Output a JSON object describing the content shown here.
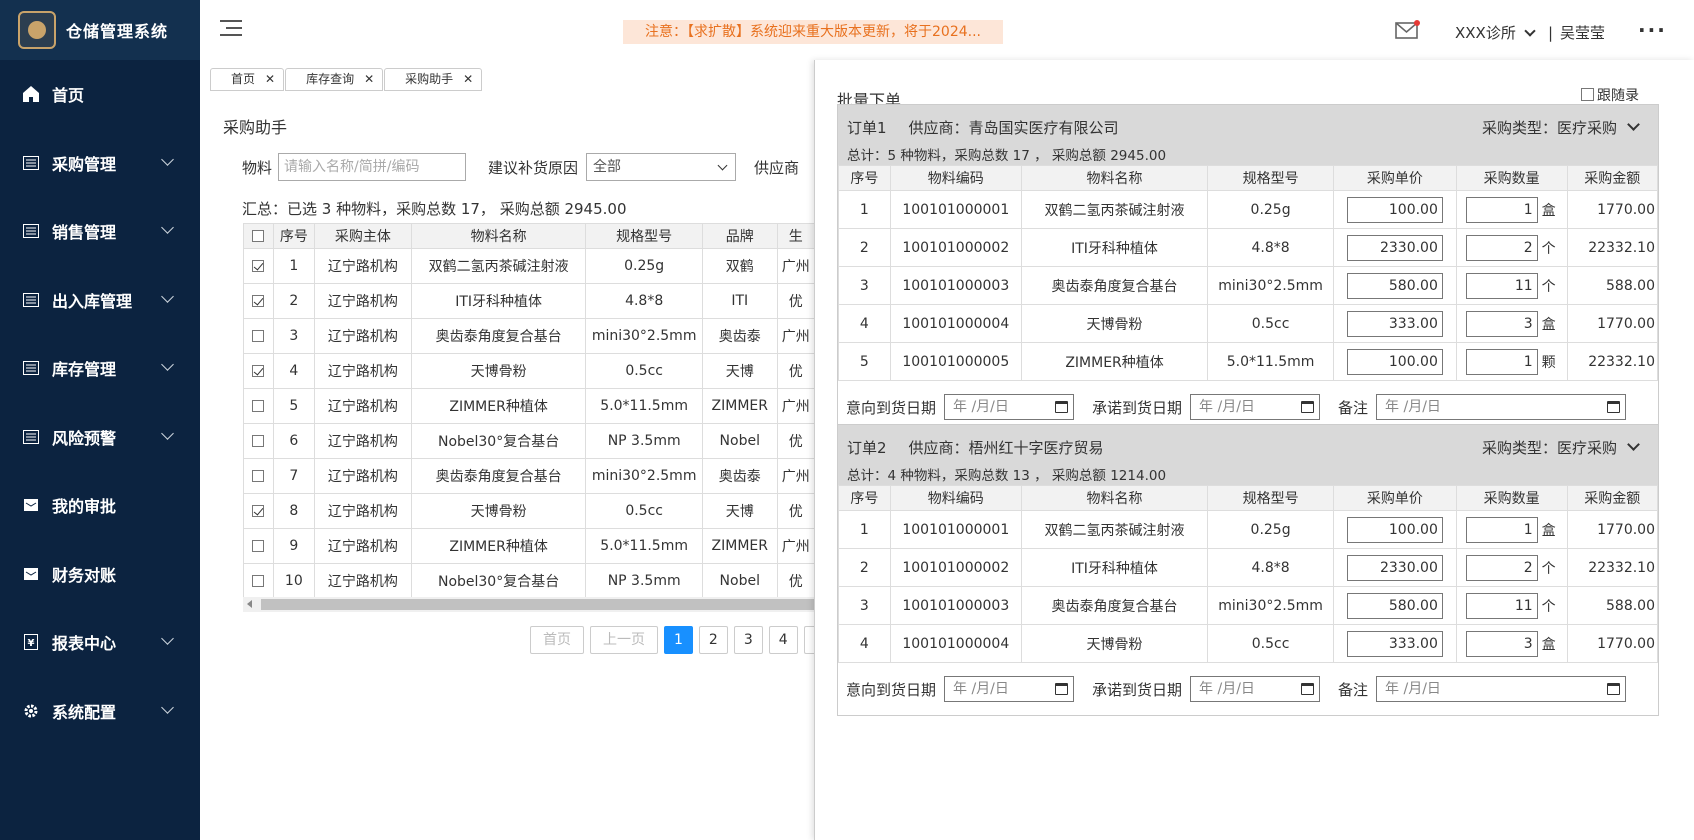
{
  "app": {
    "name": "仓储管理系统"
  },
  "sidebar": {
    "items": [
      {
        "label": "首页",
        "icon": "home-icon",
        "expandable": false
      },
      {
        "label": "采购管理",
        "icon": "list-icon",
        "expandable": true
      },
      {
        "label": "销售管理",
        "icon": "list-icon",
        "expandable": true
      },
      {
        "label": "出入库管理",
        "icon": "list-icon",
        "expandable": true
      },
      {
        "label": "库存管理",
        "icon": "list-icon",
        "expandable": true
      },
      {
        "label": "风险预警",
        "icon": "list-icon",
        "expandable": true
      },
      {
        "label": "我的审批",
        "icon": "inbox-icon",
        "expandable": false
      },
      {
        "label": "财务对账",
        "icon": "inbox-icon",
        "expandable": false
      },
      {
        "label": "报表中心",
        "icon": "yen-icon",
        "expandable": true
      },
      {
        "label": "系统配置",
        "icon": "gear-icon",
        "expandable": true
      }
    ]
  },
  "header": {
    "notice": "注意：【求扩散】系统迎来重大版本更新，将于2024...",
    "clinic": "XXX诊所",
    "separator": "|",
    "user": "吴莹莹",
    "more": "···"
  },
  "tabs": [
    {
      "label": "首页"
    },
    {
      "label": "库存查询"
    },
    {
      "label": "采购助手"
    }
  ],
  "page": {
    "title": "采购助手"
  },
  "filter": {
    "material_label": "物料",
    "material_placeholder": "请输入名称/简拼/编码",
    "reason_label": "建议补货原因",
    "reason_value": "全部",
    "supplier_label": "供应商"
  },
  "summary": "汇总：已选 3 种物料，采购总数 17， 采购总额 2945.00",
  "main_table": {
    "headers": [
      "序号",
      "采购主体",
      "物料名称",
      "规格型号",
      "品牌",
      "生"
    ],
    "rows": [
      {
        "checked": true,
        "no": "1",
        "entity": "辽宁路机构",
        "name": "双鹤二氢丙茶碱注射液",
        "spec": "0.25g",
        "brand": "双鹤",
        "extra": "广州"
      },
      {
        "checked": true,
        "no": "2",
        "entity": "辽宁路机构",
        "name": "ITI牙科种植体",
        "spec": "4.8*8",
        "brand": "ITI",
        "extra": "优"
      },
      {
        "checked": false,
        "no": "3",
        "entity": "辽宁路机构",
        "name": "奥齿泰角度复合基台",
        "spec": "mini30°2.5mm",
        "brand": "奥齿泰",
        "extra": "广州"
      },
      {
        "checked": true,
        "no": "4",
        "entity": "辽宁路机构",
        "name": "天博骨粉",
        "spec": "0.5cc",
        "brand": "天博",
        "extra": "优"
      },
      {
        "checked": false,
        "no": "5",
        "entity": "辽宁路机构",
        "name": "ZIMMER种植体",
        "spec": "5.0*11.5mm",
        "brand": "ZIMMER",
        "extra": "广州"
      },
      {
        "checked": false,
        "no": "6",
        "entity": "辽宁路机构",
        "name": "Nobel30°复合基台",
        "spec": "NP 3.5mm",
        "brand": "Nobel",
        "extra": "优"
      },
      {
        "checked": false,
        "no": "7",
        "entity": "辽宁路机构",
        "name": "奥齿泰角度复合基台",
        "spec": "mini30°2.5mm",
        "brand": "奥齿泰",
        "extra": "广州"
      },
      {
        "checked": true,
        "no": "8",
        "entity": "辽宁路机构",
        "name": "天博骨粉",
        "spec": "0.5cc",
        "brand": "天博",
        "extra": "优"
      },
      {
        "checked": false,
        "no": "9",
        "entity": "辽宁路机构",
        "name": "ZIMMER种植体",
        "spec": "5.0*11.5mm",
        "brand": "ZIMMER",
        "extra": "广州"
      },
      {
        "checked": false,
        "no": "10",
        "entity": "辽宁路机构",
        "name": "Nobel30°复合基台",
        "spec": "NP 3.5mm",
        "brand": "Nobel",
        "extra": "优"
      }
    ]
  },
  "pager": {
    "first": "首页",
    "prev": "上一页",
    "pages": [
      "1",
      "2",
      "3",
      "4"
    ],
    "current": "1"
  },
  "panel": {
    "title": "批量下单",
    "follow_label": "跟随录入",
    "columns": [
      "序号",
      "物料编码",
      "物料名称",
      "规格型号",
      "采购单价",
      "采购数量",
      "采购金额"
    ],
    "date_labels": {
      "intended": "意向到货日期",
      "promised": "承诺到货日期",
      "remark": "备注",
      "placeholder": "年 /月/日"
    },
    "orders": [
      {
        "title": "订单1",
        "supplier": "供应商：青岛国实医疗有限公司",
        "type": "采购类型：医疗采购",
        "summary": "总计：5 种物料，采购总数 17 ， 采购总额 2945.00",
        "rows": [
          {
            "no": "1",
            "code": "100101000001",
            "name": "双鹤二氢丙茶碱注射液",
            "spec": "0.25g",
            "price": "100.00",
            "qty": "1",
            "unit": "盒",
            "amount": "1770.00"
          },
          {
            "no": "2",
            "code": "100101000002",
            "name": "ITI牙科种植体",
            "spec": "4.8*8",
            "price": "2330.00",
            "qty": "2",
            "unit": "个",
            "amount": "22332.10"
          },
          {
            "no": "3",
            "code": "100101000003",
            "name": "奥齿泰角度复合基台",
            "spec": "mini30°2.5mm",
            "price": "580.00",
            "qty": "11",
            "unit": "个",
            "amount": "588.00"
          },
          {
            "no": "4",
            "code": "100101000004",
            "name": "天博骨粉",
            "spec": "0.5cc",
            "price": "333.00",
            "qty": "3",
            "unit": "盒",
            "amount": "1770.00"
          },
          {
            "no": "5",
            "code": "100101000005",
            "name": "ZIMMER种植体",
            "spec": "5.0*11.5mm",
            "price": "100.00",
            "qty": "1",
            "unit": "颗",
            "amount": "22332.10"
          }
        ]
      },
      {
        "title": "订单2",
        "supplier": "供应商：梧州红十字医疗贸易",
        "type": "采购类型：医疗采购",
        "summary": "总计：4 种物料，采购总数 13 ， 采购总额 1214.00",
        "rows": [
          {
            "no": "1",
            "code": "100101000001",
            "name": "双鹤二氢丙茶碱注射液",
            "spec": "0.25g",
            "price": "100.00",
            "qty": "1",
            "unit": "盒",
            "amount": "1770.00"
          },
          {
            "no": "2",
            "code": "100101000002",
            "name": "ITI牙科种植体",
            "spec": "4.8*8",
            "price": "2330.00",
            "qty": "2",
            "unit": "个",
            "amount": "22332.10"
          },
          {
            "no": "3",
            "code": "100101000003",
            "name": "奥齿泰角度复合基台",
            "spec": "mini30°2.5mm",
            "price": "580.00",
            "qty": "11",
            "unit": "个",
            "amount": "588.00"
          },
          {
            "no": "4",
            "code": "100101000004",
            "name": "天博骨粉",
            "spec": "0.5cc",
            "price": "333.00",
            "qty": "3",
            "unit": "盒",
            "amount": "1770.00"
          }
        ]
      }
    ]
  },
  "colors": {
    "sidebar": "#0c2340",
    "accent": "#1890ff",
    "notice_bg": "#fde6d8",
    "notice_text": "#e8711f"
  }
}
